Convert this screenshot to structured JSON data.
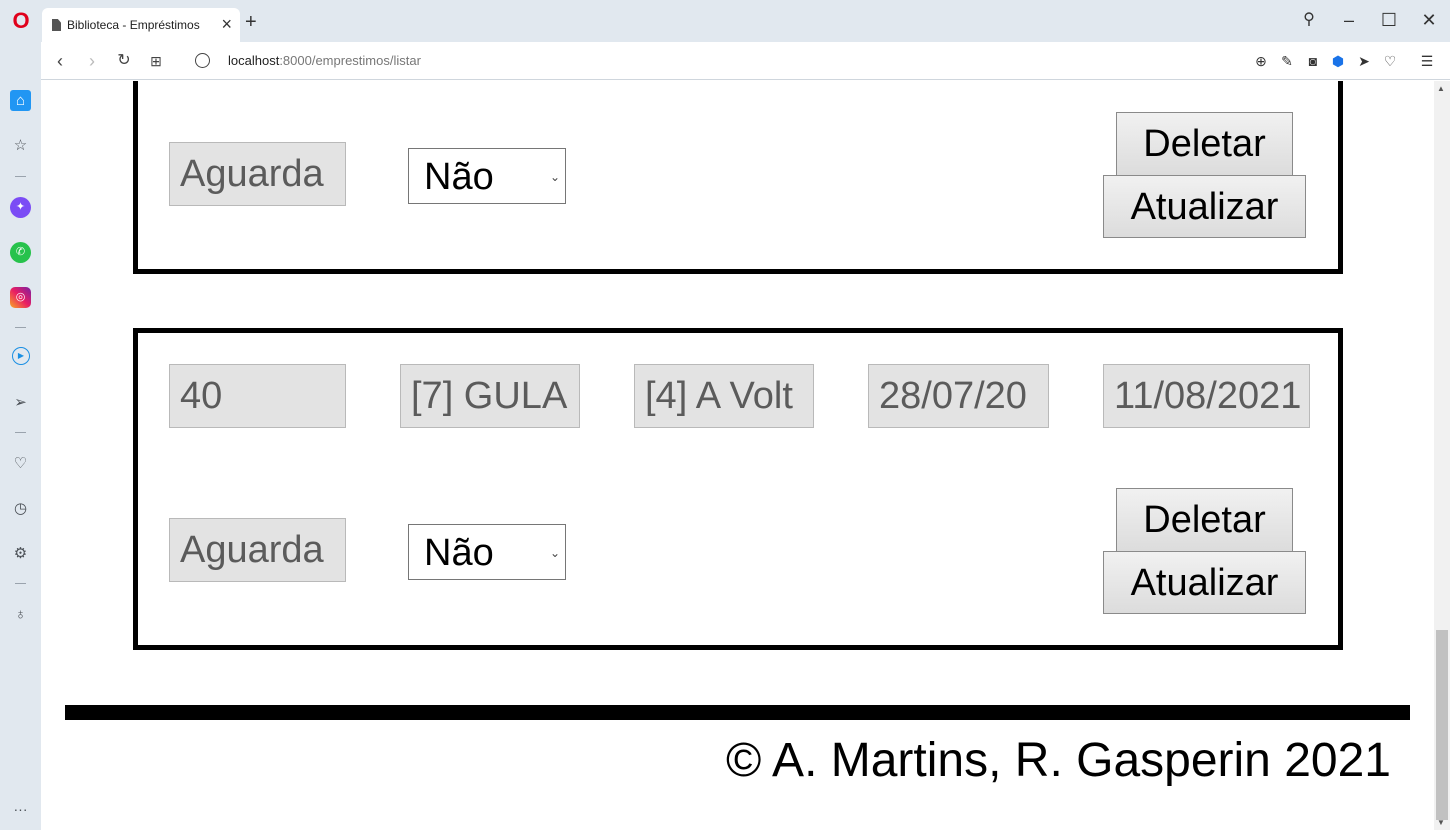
{
  "browser": {
    "tab_title": "Biblioteca - Empréstimos",
    "url_host": "localhost",
    "url_path": ":8000/emprestimos/listar"
  },
  "loans": [
    {
      "status": "Aguarda",
      "returned": "Não",
      "delete_label": "Deletar",
      "update_label": "Atualizar"
    },
    {
      "id": "40",
      "user": "[7] GULA",
      "book": "[4] A Volt",
      "loan_date": "28/07/20",
      "due_date": "11/08/2021",
      "status": "Aguarda",
      "returned": "Não",
      "delete_label": "Deletar",
      "update_label": "Atualizar"
    }
  ],
  "footer": {
    "copyright": "© A. Martins, R. Gasperin 2021"
  }
}
